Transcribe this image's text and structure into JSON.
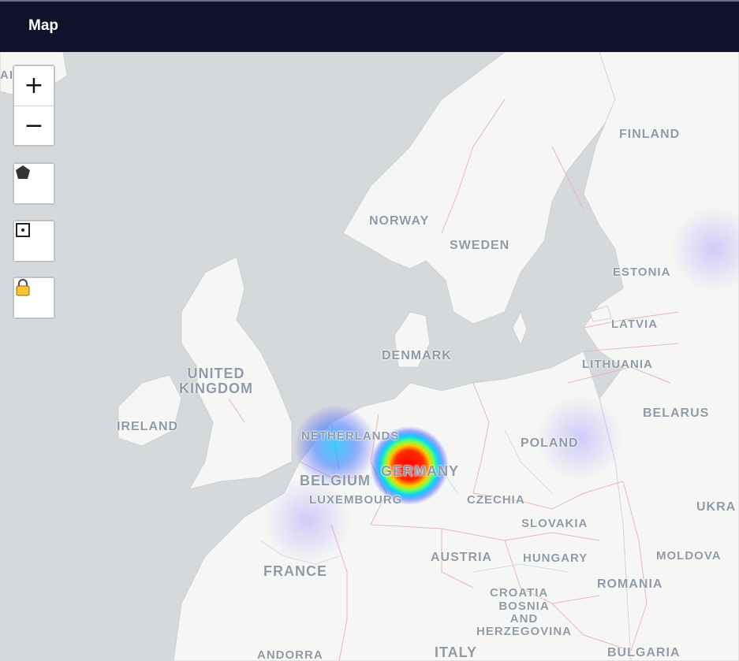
{
  "header": {
    "title": "Map"
  },
  "controls": {
    "zoom_in": "+",
    "zoom_out": "−",
    "polygon_icon": "polygon-icon",
    "rectangle_icon": "rectangle-select-icon",
    "lock_icon": "lock-icon"
  },
  "labels": {
    "finland": "FINLAND",
    "norway": "NORWAY",
    "sweden": "SWEDEN",
    "estonia": "ESTONIA",
    "latvia": "LATVIA",
    "lithuania": "LITHUANIA",
    "denmark": "DENMARK",
    "united_kingdom": "UNITED\nKINGDOM",
    "ireland": "IRELAND",
    "belarus": "BELARUS",
    "netherlands": "NETHERLANDS",
    "poland": "POLAND",
    "germany": "GERMANY",
    "belgium": "BELGIUM",
    "luxembourg": "LUXEMBOURG",
    "czechia": "CZECHIA",
    "ukraine": "UKRA",
    "slovakia": "SLOVAKIA",
    "moldova": "MOLDOVA",
    "austria": "AUSTRIA",
    "hungary": "HUNGARY",
    "france": "FRANCE",
    "romania": "ROMANIA",
    "croatia": "CROATIA",
    "bosnia": "BOSNIA\nAND\nHERZEGOVINA",
    "andorra": "ANDORRA",
    "italy": "ITALY",
    "bulgaria": "BULGARIA",
    "edge_fragment": "AI"
  },
  "heatmap": {
    "colors": {
      "high": "#ff0000",
      "mid": "#ffff00",
      "low": "#00ff7f",
      "cold": "#3fa0ff",
      "faint": "#7b6cff"
    }
  }
}
